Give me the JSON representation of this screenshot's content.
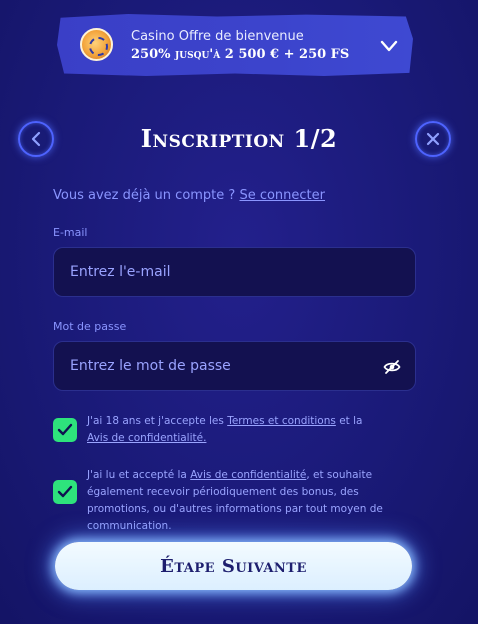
{
  "banner": {
    "title": "Casino Offre de bienvenue",
    "offer": "250% jusqu'à 2 500 € + 250 FS"
  },
  "header": {
    "title": "Inscription 1/2"
  },
  "login": {
    "prompt": "Vous avez déjà un compte ?",
    "link": "Se connecter"
  },
  "email": {
    "label": "E-mail",
    "placeholder": "Entrez l'e-mail"
  },
  "password": {
    "label": "Mot de passe",
    "placeholder": "Entrez le mot de passe"
  },
  "consent1": {
    "checked": true,
    "part1": "J'ai 18 ans et j'accepte les ",
    "terms_link": "Termes et conditions",
    "part2": " et la ",
    "privacy_link": "Avis de confidentialité."
  },
  "consent2": {
    "checked": true,
    "part1": "J'ai lu et accepté la ",
    "privacy_link": "Avis de confidentialité",
    "part2": ", et souhaite également recevoir périodiquement des bonus, des promotions, ou d'autres informations par tout moyen de communication."
  },
  "next_button": "Étape Suivante",
  "colors": {
    "accent": "#4e63ff",
    "checkbox": "#2ee37c",
    "background": "#1a1a78"
  },
  "icons": {
    "back": "chevron-left-icon",
    "close": "close-icon",
    "eye": "eye-hidden-icon",
    "expand": "chevron-down-icon",
    "bonus": "bonus-wheel-icon",
    "check": "check-icon"
  }
}
